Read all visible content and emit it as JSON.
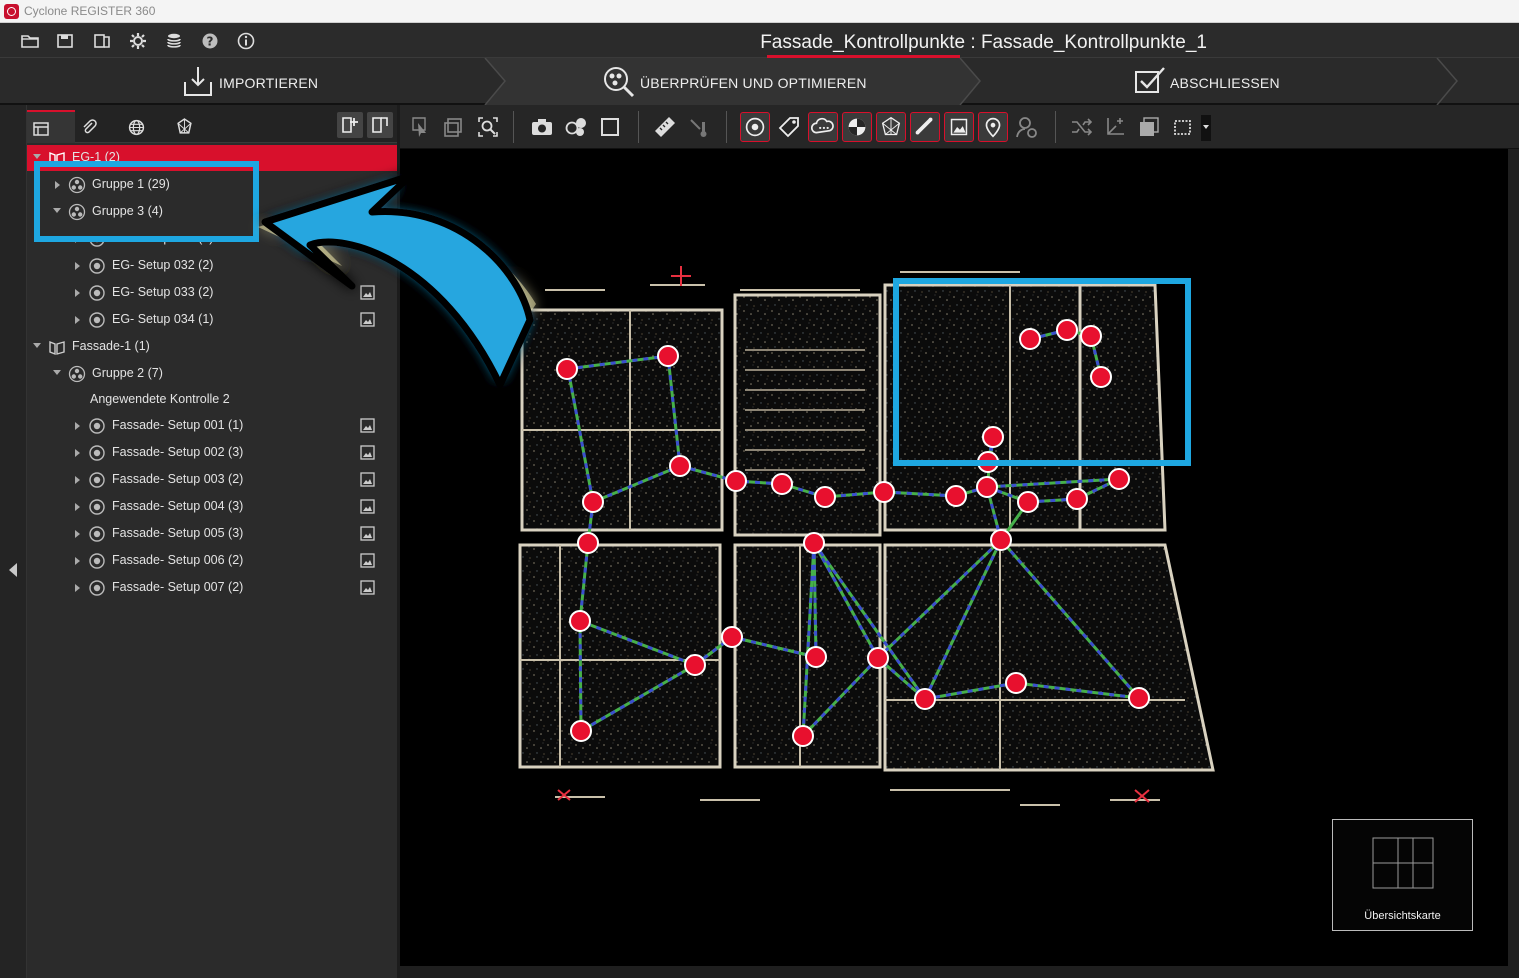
{
  "app": {
    "title": "Cyclone REGISTER 360",
    "project_title": "Fassade_Kontrollpunkte : Fassade_Kontrollpunkte_1"
  },
  "toolbar_icons": [
    "open-folder-icon",
    "save-icon",
    "report-icon",
    "settings-gear-icon",
    "database-icon",
    "help-icon",
    "info-icon"
  ],
  "workflow": {
    "tabs": [
      {
        "label": "IMPORTIEREN",
        "icon": "import-icon"
      },
      {
        "label": "ÜBERPRÜFEN UND OPTIMIEREN",
        "icon": "review-search-icon",
        "active": true
      },
      {
        "label": "ABSCHLIESSEN",
        "icon": "finalize-check-icon"
      }
    ]
  },
  "panel": {
    "tabs": [
      "bundle-list-icon",
      "attachment-icon",
      "globe-icon",
      "cloud-constraint-icon"
    ],
    "tree": [
      {
        "label": "EG-1 (2)",
        "type": "bundle",
        "selected": true
      },
      {
        "label": "Gruppe 1 (29)",
        "type": "group"
      },
      {
        "label": "Gruppe 3 (4)",
        "type": "group"
      },
      {
        "label": "EG- Setup 031 (1)",
        "type": "setup"
      },
      {
        "label": "EG- Setup 032 (2)",
        "type": "setup"
      },
      {
        "label": "EG- Setup 033 (2)",
        "type": "setup",
        "has_image": true
      },
      {
        "label": "EG- Setup 034 (1)",
        "type": "setup",
        "has_image": true
      },
      {
        "label": "Fassade-1 (1)",
        "type": "bundle"
      },
      {
        "label": "Gruppe 2 (7)",
        "type": "group"
      },
      {
        "label": "Angewendete Kontrolle 2",
        "type": "control"
      },
      {
        "label": "Fassade- Setup 001 (1)",
        "type": "setup",
        "has_image": true
      },
      {
        "label": "Fassade- Setup 002 (3)",
        "type": "setup",
        "has_image": true
      },
      {
        "label": "Fassade- Setup 003 (2)",
        "type": "setup",
        "has_image": true
      },
      {
        "label": "Fassade- Setup 004 (3)",
        "type": "setup",
        "has_image": true
      },
      {
        "label": "Fassade- Setup 005 (3)",
        "type": "setup",
        "has_image": true
      },
      {
        "label": "Fassade- Setup 006 (2)",
        "type": "setup",
        "has_image": true
      },
      {
        "label": "Fassade- Setup 007 (2)",
        "type": "setup",
        "has_image": true
      }
    ]
  },
  "viewport_tools": [
    "select-icon",
    "copy-icon",
    "zoom-fit-icon",
    "camera-icon",
    "spheres-icon",
    "square-icon",
    "measure-icon",
    "thermometer-icon",
    "setup-target-icon",
    "tag-icon",
    "cloud-icon",
    "checker-target-icon",
    "mesh-icon",
    "ruler-icon",
    "image-icon",
    "location-pin-icon",
    "person-settings-icon",
    "shuffle-icon",
    "axis-icon",
    "layers-icon",
    "selection-box-icon"
  ],
  "overview": {
    "label": "Übersichtskarte"
  },
  "colors": {
    "accent": "#d8102c",
    "highlight_box": "#1ea7e1",
    "link_green": "#4caf50",
    "link_blue": "#3f51b5",
    "node": "#e8102e"
  }
}
